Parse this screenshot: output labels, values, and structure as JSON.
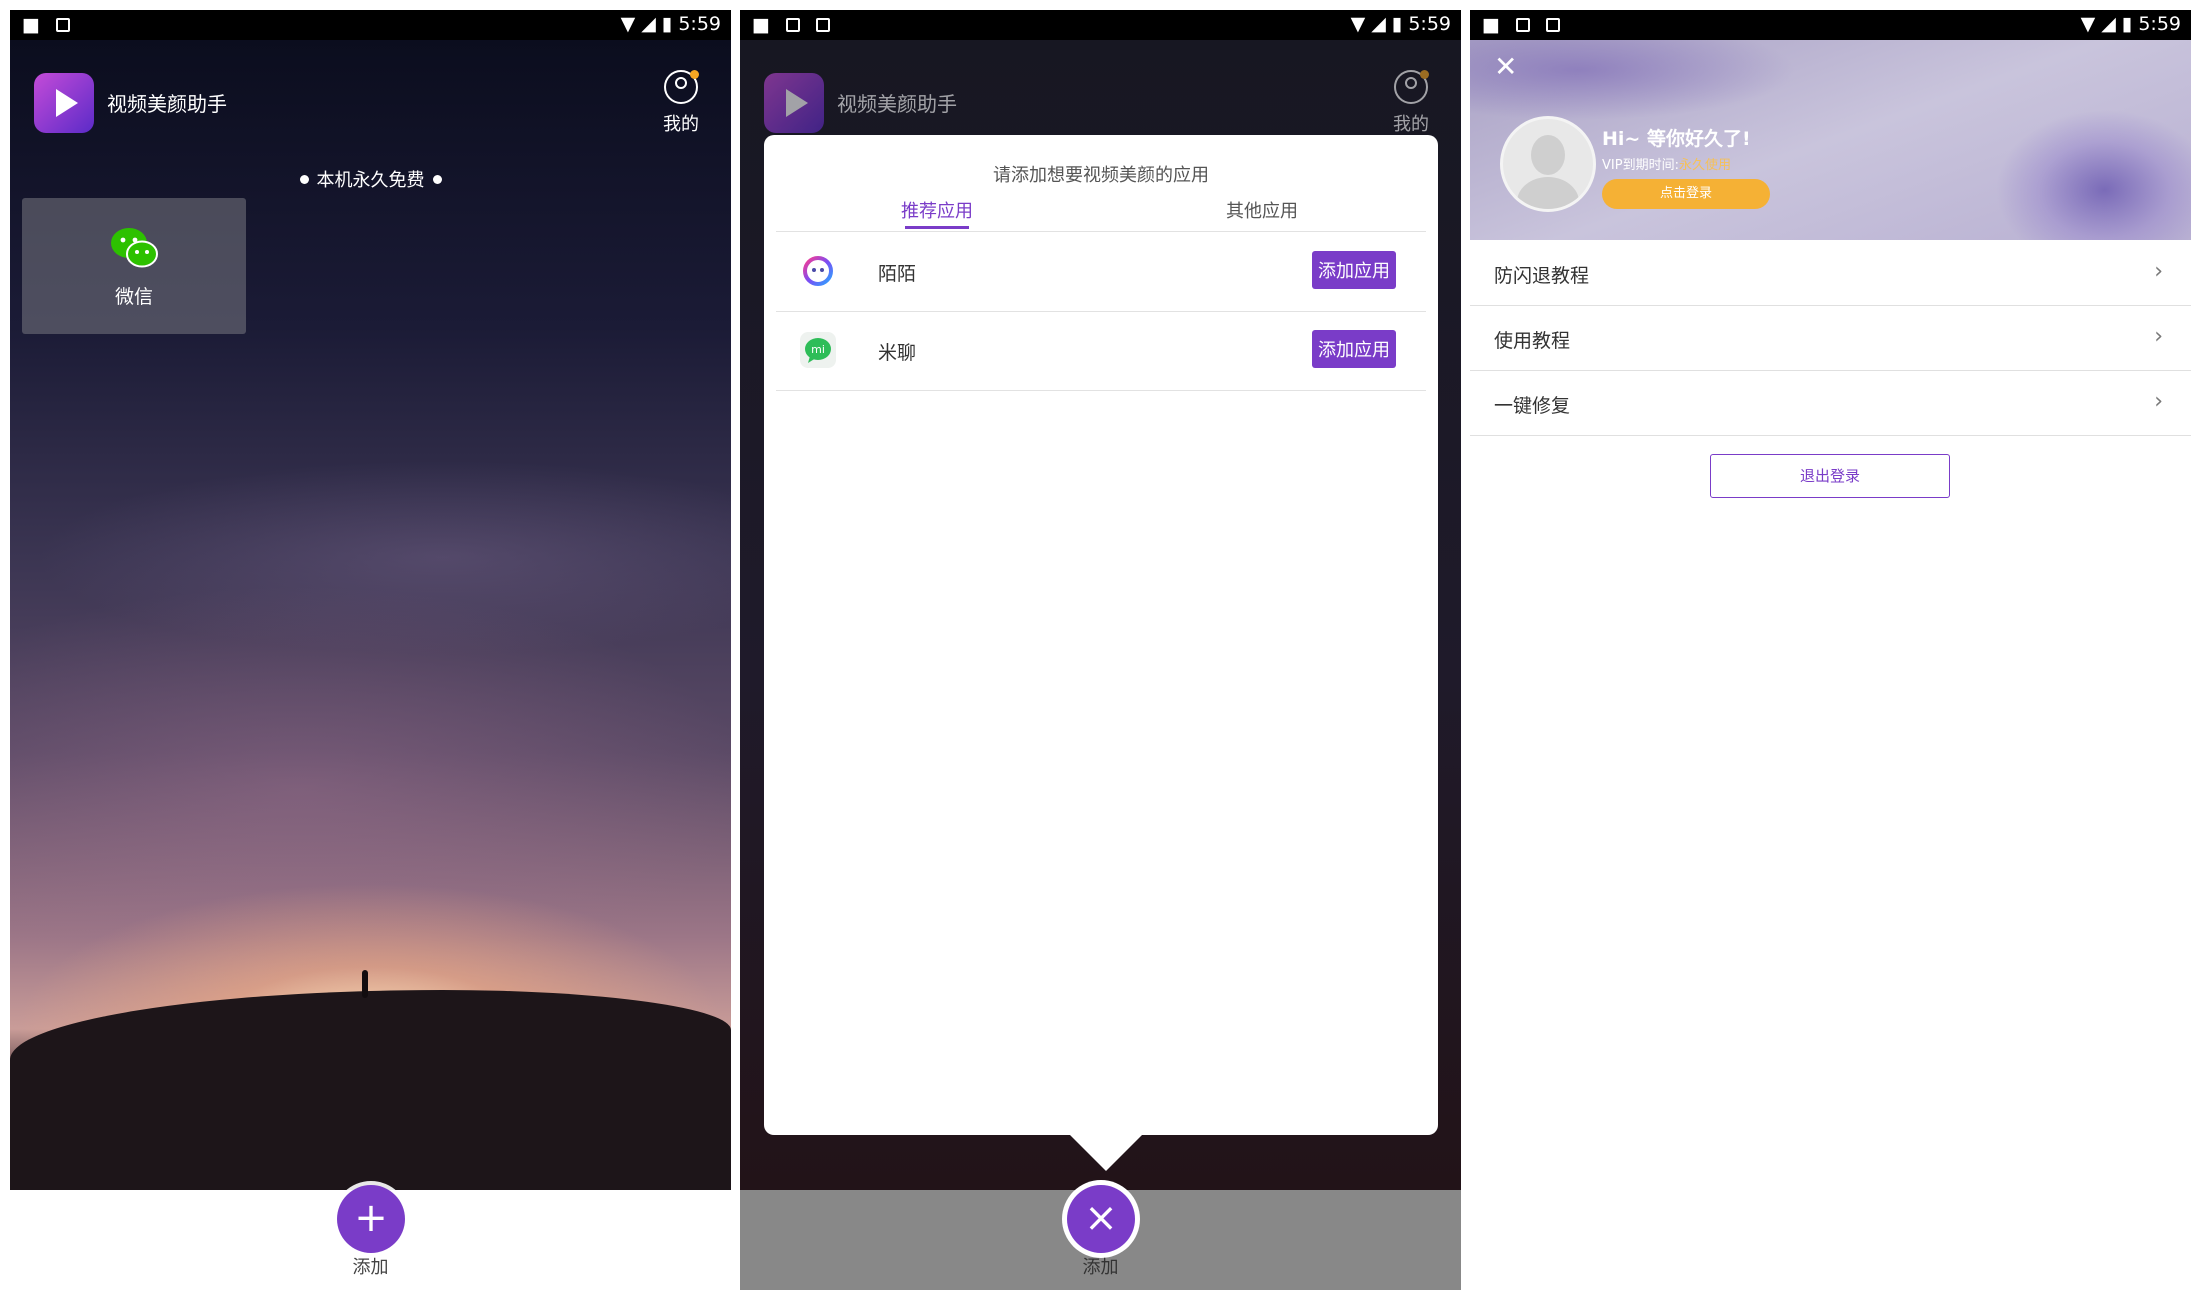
{
  "statusbar": {
    "time": "5:59"
  },
  "home": {
    "app_name": "视频美颜助手",
    "me_label": "我的",
    "free_text": "本机永久免费",
    "app_tile_label": "微信",
    "fab_label": "添加",
    "fab_icon": "plus-icon"
  },
  "dialog": {
    "app_name": "视频美颜助手",
    "me_label": "我的",
    "title": "请添加想要视频美颜的应用",
    "tabs": [
      {
        "label": "推荐应用",
        "active": true
      },
      {
        "label": "其他应用",
        "active": false
      }
    ],
    "rows": [
      {
        "name": "陌陌",
        "button": "添加应用",
        "icon": "momo-icon"
      },
      {
        "name": "米聊",
        "button": "添加应用",
        "icon": "miliao-icon"
      }
    ],
    "fab_label": "添加",
    "fab_icon": "close-icon"
  },
  "profile": {
    "greeting": "Hi~ 等你好久了!",
    "vip_label": "VIP到期时间:",
    "vip_value": "永久使用",
    "login_button": "点击登录",
    "menu": [
      {
        "label": "防闪退教程"
      },
      {
        "label": "使用教程"
      },
      {
        "label": "一键修复"
      }
    ],
    "logout_button": "退出登录"
  },
  "colors": {
    "accent": "#7a3cc8",
    "login_orange": "#f5b135",
    "wechat_green": "#2dc100"
  }
}
